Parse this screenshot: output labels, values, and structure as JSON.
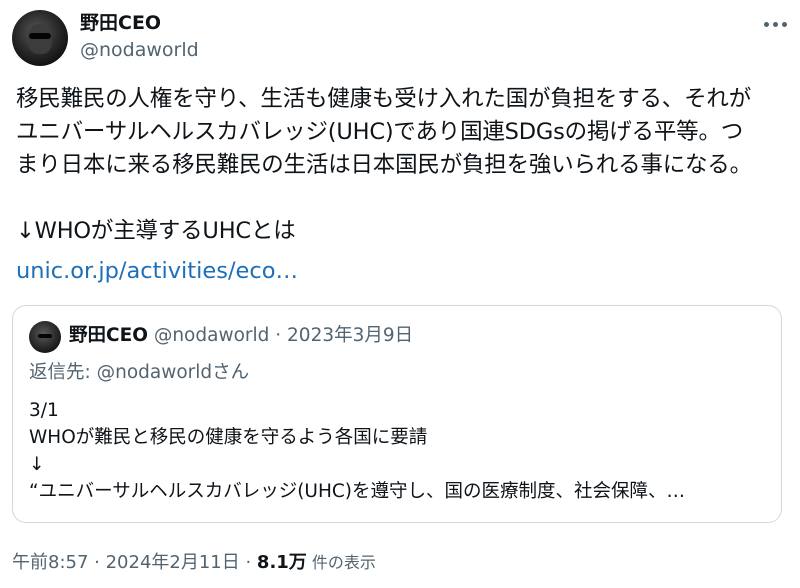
{
  "author": {
    "display_name": "野田CEO",
    "handle": "@nodaworld"
  },
  "tweet": {
    "body": "移民難民の人権を守り、生活も健康も受け入れた国が負担をする、それが\nユニバーサルヘルスカバレッジ(UHC)であり国連SDGsの掲げる平等。つ\nまり日本に来る移民難民の生活は日本国民が負担を強いられる事になる。\n\n↓WHOが主導するUHCとは",
    "link_text": "unic.or.jp/activities/eco…"
  },
  "quoted_tweet": {
    "display_name": "野田CEO",
    "meta": " @nodaworld · 2023年3月9日",
    "reply_to": "返信先: @nodaworldさん",
    "body": "3/1\nWHOが難民と移民の健康を守るよう各国に要請\n↓\n“ユニバーサルヘルスカバレッジ(UHC)を遵守し、国の医療制度、社会保障、…"
  },
  "footer": {
    "time_date": "午前8:57 · 2024年2月11日 · ",
    "views_count": "8.1万",
    "views_label": " 件の表示"
  },
  "icons": {
    "more": "more-horizontal-icon"
  },
  "colors": {
    "text_primary": "#0f1419",
    "text_secondary": "#536471",
    "link": "#1d6fb8",
    "border": "#cfd9de"
  }
}
